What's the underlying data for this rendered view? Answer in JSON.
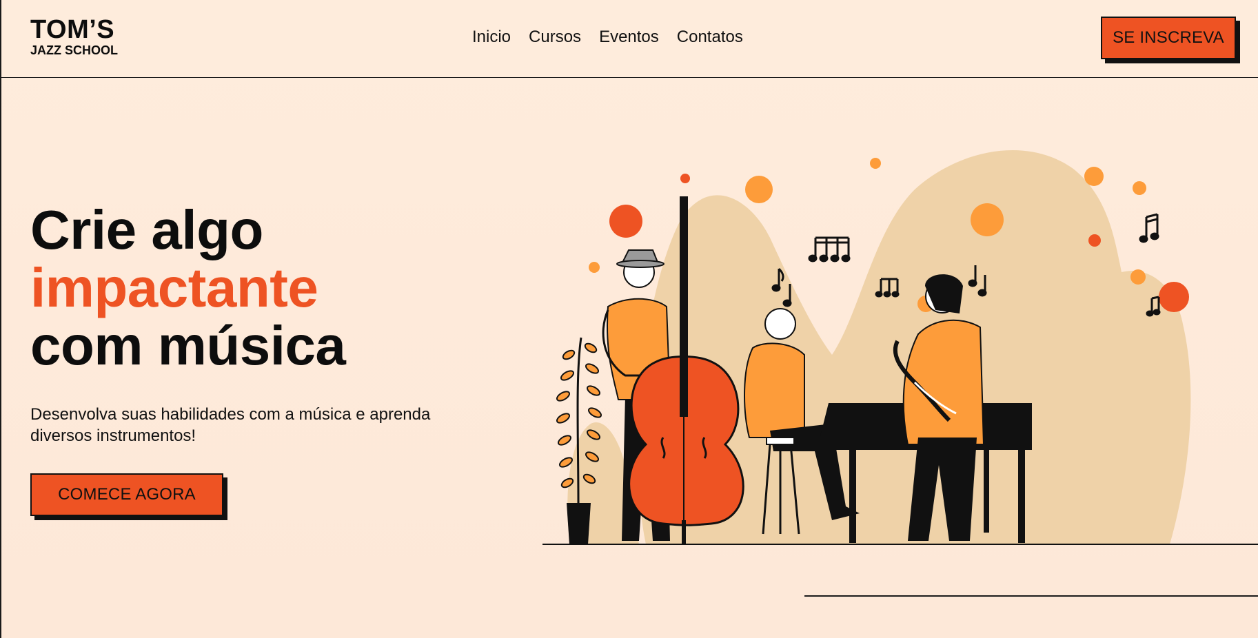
{
  "header": {
    "logo_main": "TOM’S",
    "logo_sub": "JAZZ SCHOOL",
    "nav": [
      "Inicio",
      "Cursos",
      "Eventos",
      "Contatos"
    ],
    "signup_label": "SE INSCREVA"
  },
  "hero": {
    "title_line1": "Crie algo",
    "title_line2": "impactante",
    "title_line3": "com música",
    "description": "Desenvolva suas habilidades com a música e aprenda diversos instrumentos!",
    "cta_label": "COMECE AGORA"
  },
  "colors": {
    "background": "#fdebdb",
    "accent": "#ee5323",
    "secondary": "#fd9c3a",
    "blob": "#efd2a8",
    "ink": "#0d0d0d"
  },
  "illustration": {
    "icon": "jazz-band-illustration"
  }
}
